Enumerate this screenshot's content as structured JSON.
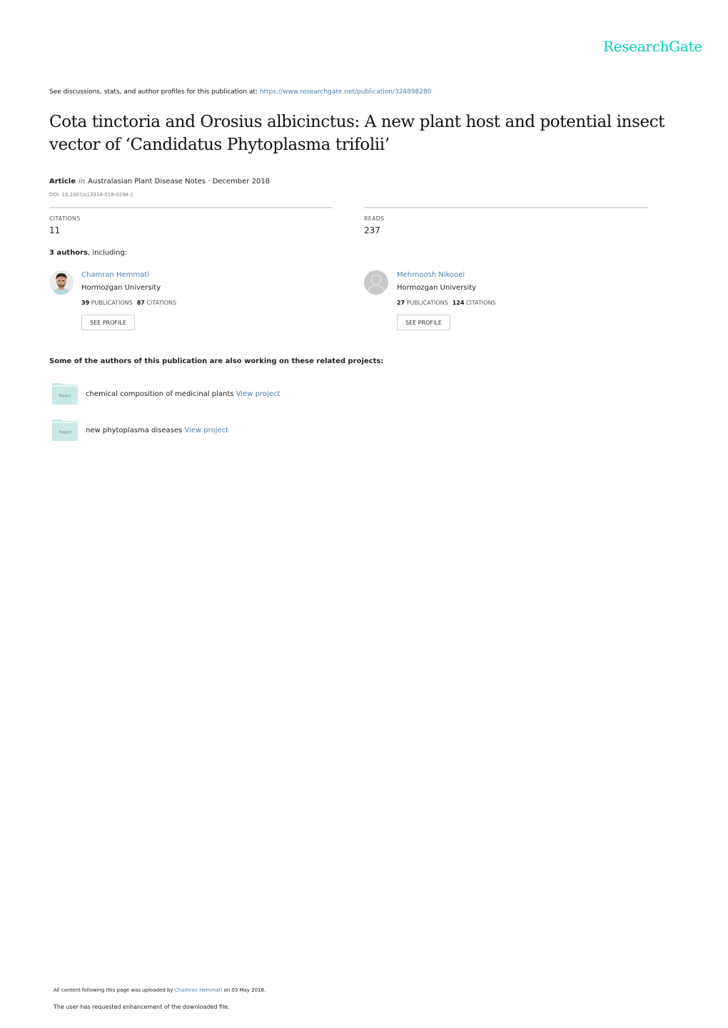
{
  "brand": {
    "name": "ResearchGate",
    "color": "#00ccbb"
  },
  "header": {
    "see_discussions": "See discussions, stats, and author profiles for this publication at: ",
    "publication_url": "https://www.researchgate.net/publication/324898280"
  },
  "publication": {
    "title": "Cota tinctoria and Orosius albicinctus: A new plant host and potential insect vector of ‘Candidatus Phytoplasma trifolii’",
    "type": "Article",
    "in_label": "in",
    "journal": "Australasian Plant Disease Notes",
    "date_sep": " · ",
    "date": "December 2018",
    "doi": "DOI: 10.1007/s13314-018-0298-1"
  },
  "stats": {
    "citations_label": "CITATIONS",
    "citations_value": "11",
    "reads_label": "READS",
    "reads_value": "237"
  },
  "authors_section": {
    "count_label": "3 authors",
    "suffix": ", including:",
    "authors": [
      {
        "name": "Chamran Hemmati",
        "institution": "Hormozgan University",
        "publications": "39",
        "publications_label": "PUBLICATIONS",
        "citations": "87",
        "citations_label": "CITATIONS",
        "button": "SEE PROFILE",
        "avatar": "photo"
      },
      {
        "name": "Mehrnoosh Nikooei",
        "institution": "Hormozgan University",
        "publications": "27",
        "publications_label": "PUBLICATIONS",
        "citations": "124",
        "citations_label": "CITATIONS",
        "button": "SEE PROFILE",
        "avatar": "default-silhouette"
      }
    ]
  },
  "related": {
    "heading": "Some of the authors of this publication are also working on these related projects:",
    "projects": [
      {
        "icon_label": "Project",
        "name": "chemical composition of medicinal plants",
        "link": "View project"
      },
      {
        "icon_label": "Project",
        "name": "new phytoplasma diseases",
        "link": "View project"
      }
    ]
  },
  "footer": {
    "uploaded_prefix": "All content following this page was uploaded by ",
    "uploader": "Chamran Hemmati",
    "uploaded_suffix": " on 03 May 2018.",
    "enhancement_note": "The user has requested enhancement of the downloaded file."
  }
}
